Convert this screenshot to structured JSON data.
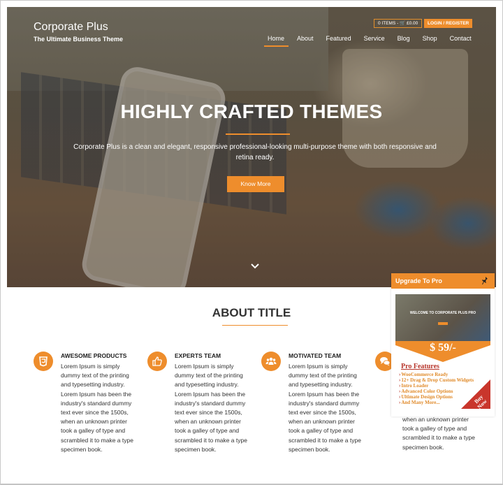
{
  "header": {
    "site_title": "Corporate Plus",
    "tagline": "The Ultimate Business Theme",
    "cart_label": "0 ITEMS - 🛒 £0.00",
    "login_label": "LOGIN / REGISTER"
  },
  "nav": {
    "items": [
      {
        "label": "Home",
        "active": true
      },
      {
        "label": "About",
        "active": false
      },
      {
        "label": "Featured",
        "active": false
      },
      {
        "label": "Service",
        "active": false
      },
      {
        "label": "Blog",
        "active": false
      },
      {
        "label": "Shop",
        "active": false
      },
      {
        "label": "Contact",
        "active": false
      }
    ]
  },
  "hero": {
    "title": "HIGHLY CRAFTED THEMES",
    "text": "Corporate Plus is a clean  and elegant, responsive professional-looking multi-purpose theme with both responsive and retina ready.",
    "button_label": "Know More",
    "scroll_icon": "chevron-down-icon"
  },
  "about": {
    "title": "ABOUT TITLE",
    "features": [
      {
        "icon": "css3-icon",
        "title": "AWESOME PRODUCTS",
        "body": "Lorem Ipsum is simply dummy text of the printing and typesetting industry. Lorem Ipsum has been the industry's standard dummy text ever since the 1500s, when an unknown printer took a galley of type and scrambled it to make a type specimen book."
      },
      {
        "icon": "thumbs-up-icon",
        "title": "EXPERTS TEAM",
        "body": "Lorem Ipsum is simply dummy text of the printing and typesetting industry. Lorem Ipsum has been the industry's standard dummy text ever since the 1500s, when an unknown printer took a galley of type and scrambled it to make a type specimen book."
      },
      {
        "icon": "users-icon",
        "title": "MOTIVATED TEAM",
        "body": "Lorem Ipsum is simply dummy text of the printing and typesetting industry. Lorem Ipsum has been the industry's standard dummy text ever since the 1500s, when an unknown printer took a galley of type and scrambled it to make a type specimen book."
      },
      {
        "icon": "comments-icon",
        "title": "",
        "body_visible": "when an unknown printer took a galley of type and scrambled it to make a type specimen book."
      }
    ]
  },
  "promo": {
    "header": "Upgrade To Pro",
    "pin_icon": "pin-icon",
    "screenshot_title": "WELCOME TO CORPORATE PLUS PRO",
    "price": "$ 59/-",
    "features_title": "Pro Features",
    "features": [
      "WooCommerce Ready",
      "12+ Drag & Drop Custom Widgets",
      "Intro Loader",
      "Advanced Color Options",
      "Ultimate Design Options",
      "And Many More..."
    ],
    "buy_label_1": "Buy",
    "buy_label_2": "Now"
  },
  "colors": {
    "accent": "#ee8d2c",
    "promo_red": "#b7362c",
    "text_dark": "#333333"
  }
}
